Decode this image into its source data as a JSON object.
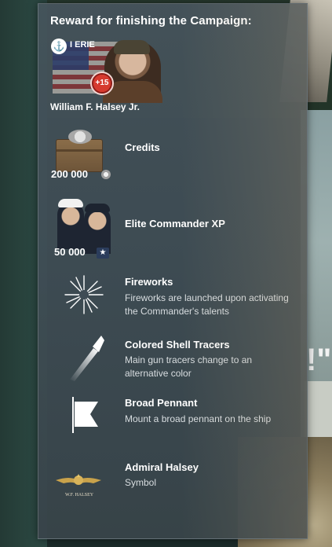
{
  "panel": {
    "title": "Reward for finishing the Campaign:"
  },
  "commander": {
    "ship_label": "I ERIE",
    "bonus": "+15",
    "name": "William F. Halsey Jr."
  },
  "rewards": [
    {
      "title": "Credits",
      "quantity": "200 000",
      "icon": "credits-icon"
    },
    {
      "title": "Elite Commander XP",
      "quantity": "50 000",
      "icon": "elite-commander-xp-icon"
    },
    {
      "title": "Fireworks",
      "description": "Fireworks are launched upon activating the Commander's talents",
      "icon": "fireworks-icon"
    },
    {
      "title": "Colored Shell Tracers",
      "description": "Main gun tracers change to an alternative color",
      "icon": "shell-tracer-icon"
    },
    {
      "title": "Broad Pennant",
      "description": "Mount a broad pennant on the ship",
      "icon": "broad-pennant-icon"
    },
    {
      "title": "Admiral Halsey",
      "description": "Symbol",
      "icon": "admiral-halsey-symbol-icon",
      "symbol_text": "W.F. HALSEY"
    }
  ],
  "background": {
    "quote_mark": "!\""
  }
}
